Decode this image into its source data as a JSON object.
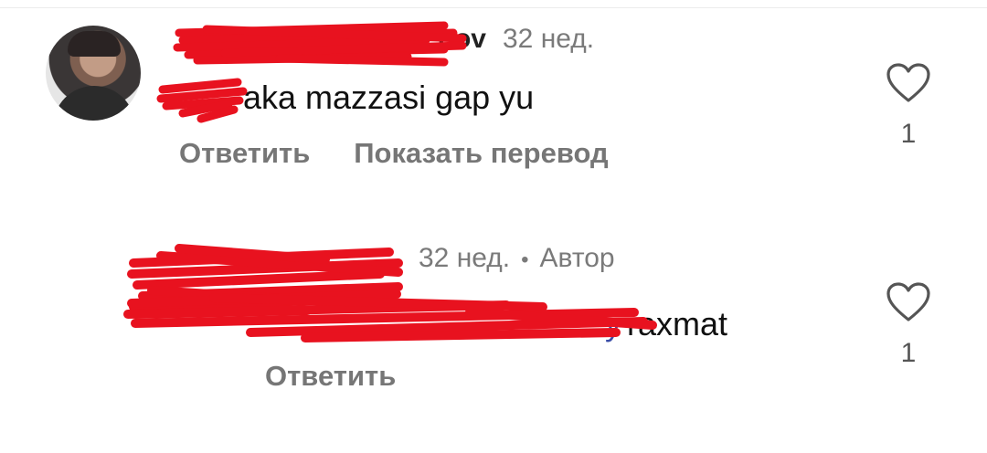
{
  "comments": [
    {
      "username": "…bov",
      "time": "32 нед.",
      "text_prefix": "",
      "text": "aka mazzasi gap yu",
      "actions": {
        "reply": "Ответить",
        "translate": "Показать перевод"
      },
      "likes": "1",
      "redacted": true
    },
    {
      "username": "",
      "time": "32 нед.",
      "separator": "•",
      "author_badge": "Автор",
      "mention": "…y",
      "text": "raxmat",
      "actions": {
        "reply": "Ответить"
      },
      "likes": "1",
      "redacted": true
    }
  ],
  "icons": {
    "like": "heart-outline-icon"
  },
  "colors": {
    "redaction": "#e8121f",
    "muted": "#767676",
    "mention": "#3b4ea8"
  }
}
